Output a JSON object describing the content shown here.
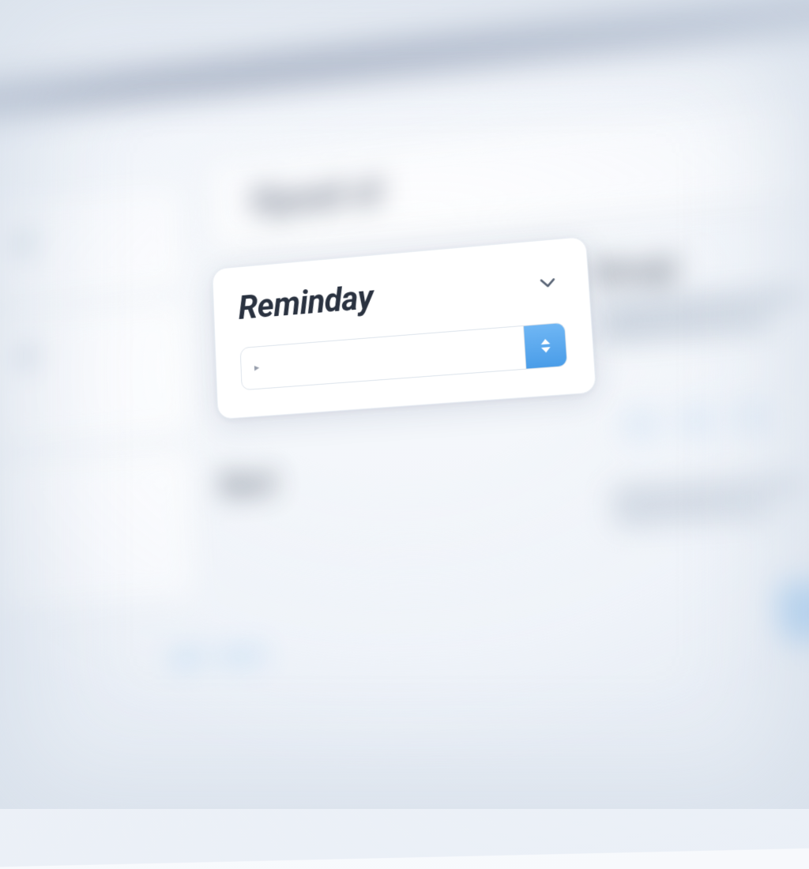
{
  "focus_card": {
    "title": "Reminday",
    "input_value": "",
    "input_placeholder": ""
  },
  "icons": {
    "chevron": "chevron-down-icon",
    "spinner": "stepper-icon",
    "caret": "▸"
  },
  "colors": {
    "accent": "#4a9de8",
    "header": "#5a6a8a",
    "text": "#2a3240"
  }
}
